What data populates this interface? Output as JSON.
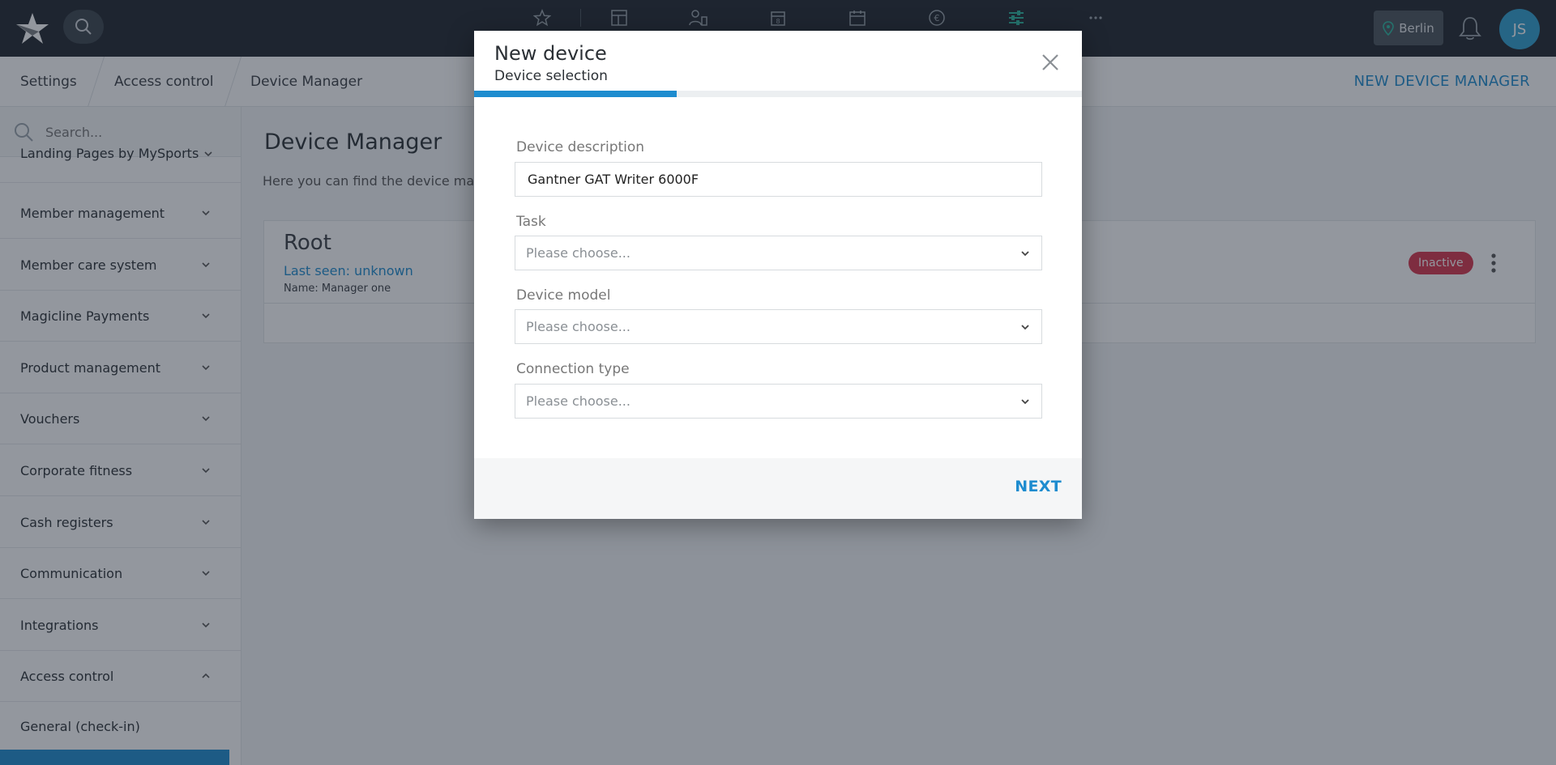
{
  "topbar": {
    "location": "Berlin",
    "avatar_initials": "JS",
    "nav_icons": [
      "star-icon",
      "layout-icon",
      "users-icon",
      "calendar-day-icon",
      "calendar-icon",
      "euro-icon",
      "sliders-icon",
      "more-icon"
    ]
  },
  "breadcrumb": [
    "Settings",
    "Access control",
    "Device Manager"
  ],
  "header_action": "NEW DEVICE MANAGER",
  "sidebar": {
    "search_placeholder": "Search...",
    "items": [
      "Landing Pages by MySports",
      "Member management",
      "Member care system",
      "Magicline Payments",
      "Product management",
      "Vouchers",
      "Corporate fitness",
      "Cash registers",
      "Communication",
      "Integrations",
      "Access control"
    ],
    "sub_items": [
      "General (check-in)"
    ]
  },
  "main": {
    "title": "Device Manager",
    "description": "Here you can find the device ma",
    "card": {
      "title": "Root",
      "last_seen": "Last seen: unknown",
      "name": "Name: Manager one",
      "status": "Inactive"
    }
  },
  "modal": {
    "title": "New device",
    "subtitle": "Device selection",
    "progress": 0.333,
    "fields": {
      "description_label": "Device description",
      "description_value": "Gantner GAT Writer 6000F",
      "task_label": "Task",
      "task_placeholder": "Please choose...",
      "model_label": "Device model",
      "model_placeholder": "Please choose...",
      "connection_label": "Connection type",
      "connection_placeholder": "Please choose..."
    },
    "next_label": "NEXT"
  },
  "colors": {
    "accent": "#1e8ccf",
    "topbar": "#1f262c",
    "inactive_badge": "#d7344c"
  }
}
